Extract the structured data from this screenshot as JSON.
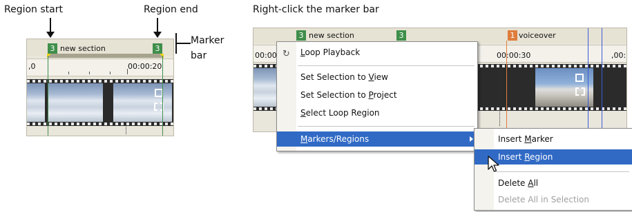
{
  "callouts": {
    "region_start": "Region start",
    "region_end": "Region end",
    "marker_bar_line1": "Marker",
    "marker_bar_line2": "bar",
    "right_title": "Right-click the marker bar"
  },
  "left_panel": {
    "marker_start_num": "3",
    "marker_end_num": "3",
    "marker_label": "new section",
    "ruler_left": ",0",
    "ruler_time": "00:00:20"
  },
  "right_panel": {
    "marker1_num": "3",
    "marker1_label": "new section",
    "marker2_num": "3",
    "marker3_num": "1",
    "marker3_label": "voiceover",
    "ruler_left": "00:00",
    "ruler_time": "00:00:30",
    "ruler_right": ",00:"
  },
  "context_menu": {
    "items": [
      {
        "pre": "",
        "u": "L",
        "post": "oop Playback",
        "icon": "loop-icon"
      },
      {
        "pre": "Set Selection to ",
        "u": "V",
        "post": "iew"
      },
      {
        "pre": "Set Selection to ",
        "u": "P",
        "post": "roject"
      },
      {
        "pre": "",
        "u": "S",
        "post": "elect Loop Region"
      },
      {
        "pre": "",
        "u": "M",
        "post": "arkers/Regions"
      }
    ]
  },
  "submenu": {
    "items": [
      {
        "pre": "Insert ",
        "u": "M",
        "post": "arker"
      },
      {
        "pre": "Insert ",
        "u": "R",
        "post": "egion"
      },
      {
        "pre": "Delete ",
        "u": "A",
        "post": "ll"
      },
      {
        "pre": "Delete All in Selection",
        "u": "",
        "post": ""
      }
    ]
  },
  "colors": {
    "menu_highlight": "#316ac5",
    "marker_green": "#3f8f4b",
    "marker_orange": "#e07d3c"
  }
}
